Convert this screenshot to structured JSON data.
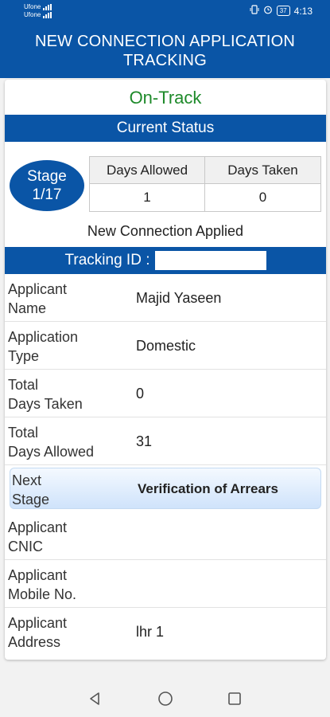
{
  "status_bar": {
    "carrier1": "Ufone",
    "carrier2": "Ufone",
    "battery": "37",
    "time": "4:13"
  },
  "header": {
    "title": "NEW CONNECTION APPLICATION TRACKING",
    "title_line1": "NEW CONNECTION APPLICATION",
    "title_line2": "TRACKING"
  },
  "status": {
    "label": "On-Track",
    "color": "#1e8a2a"
  },
  "current_status": {
    "heading": "Current Status",
    "stage_line1": "Stage",
    "stage_line2": "1/17",
    "days_allowed_label": "Days Allowed",
    "days_taken_label": "Days Taken",
    "days_allowed_value": "1",
    "days_taken_value": "0",
    "stage_name": "New Connection Applied"
  },
  "tracking": {
    "label": "Tracking ID :"
  },
  "details": [
    {
      "label_line1": "Applicant",
      "label_line2": "Name",
      "value": "Majid Yaseen"
    },
    {
      "label_line1": "Application",
      "label_line2": "Type",
      "value": "Domestic"
    },
    {
      "label_line1": "Total",
      "label_line2": "Days Taken",
      "value": "0"
    },
    {
      "label_line1": "Total",
      "label_line2": "Days Allowed",
      "value": "31"
    },
    {
      "label_line1": "Next",
      "label_line2": "Stage",
      "value": "Verification of Arrears"
    },
    {
      "label_line1": "Applicant",
      "label_line2": "CNIC",
      "value": ""
    },
    {
      "label_line1": "Applicant",
      "label_line2": "Mobile No.",
      "value": ""
    },
    {
      "label_line1": "Applicant",
      "label_line2": "Address",
      "value": "lhr 1"
    }
  ],
  "colors": {
    "primary": "#0a55a6",
    "accent_green": "#1e8a2a"
  }
}
